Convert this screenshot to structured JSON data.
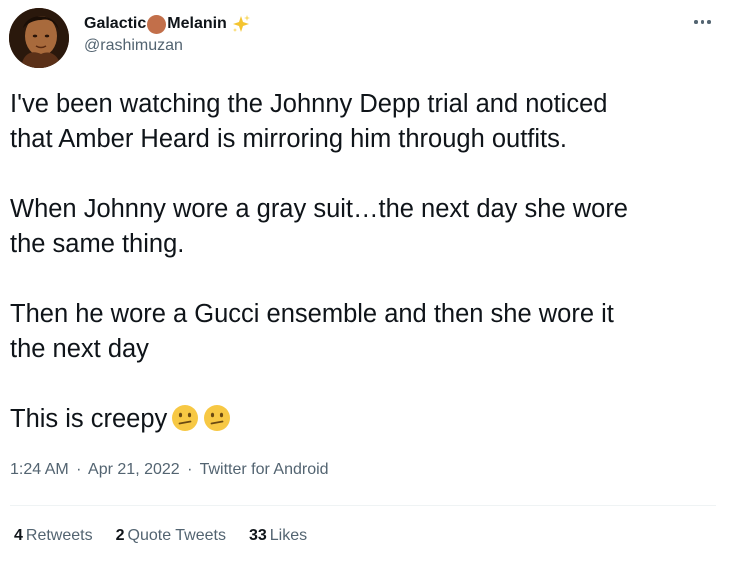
{
  "user": {
    "name_part1": "Galactic",
    "name_part2": "Melanin",
    "handle": "@rashimuzan",
    "avatar_icon": "profile-avatar",
    "name_emoji_dot_color": "#c26f4a",
    "name_emoji_sparkle": "sparkles-icon"
  },
  "tweet": {
    "line1": "I've been watching the Johnny Depp trial and noticed",
    "line2": "that Amber Heard is mirroring him through outfits.",
    "line3": "When Johnny wore a gray suit…the next day she wore",
    "line4": "the same thing.",
    "line5": "Then he wore a Gucci ensemble and then she wore it",
    "line6": "the next day",
    "line7": "This is creepy",
    "emoji": "confused-face-icon"
  },
  "meta": {
    "time": "1:24 AM",
    "date": "Apr 21, 2022",
    "source": "Twitter for Android",
    "separator": "·"
  },
  "stats": {
    "retweets_count": "4",
    "retweets_label": "Retweets",
    "quotes_count": "2",
    "quotes_label": "Quote Tweets",
    "likes_count": "33",
    "likes_label": "Likes"
  },
  "colors": {
    "text": "#0f1419",
    "secondary": "#536471",
    "divider": "#eff3f4"
  }
}
